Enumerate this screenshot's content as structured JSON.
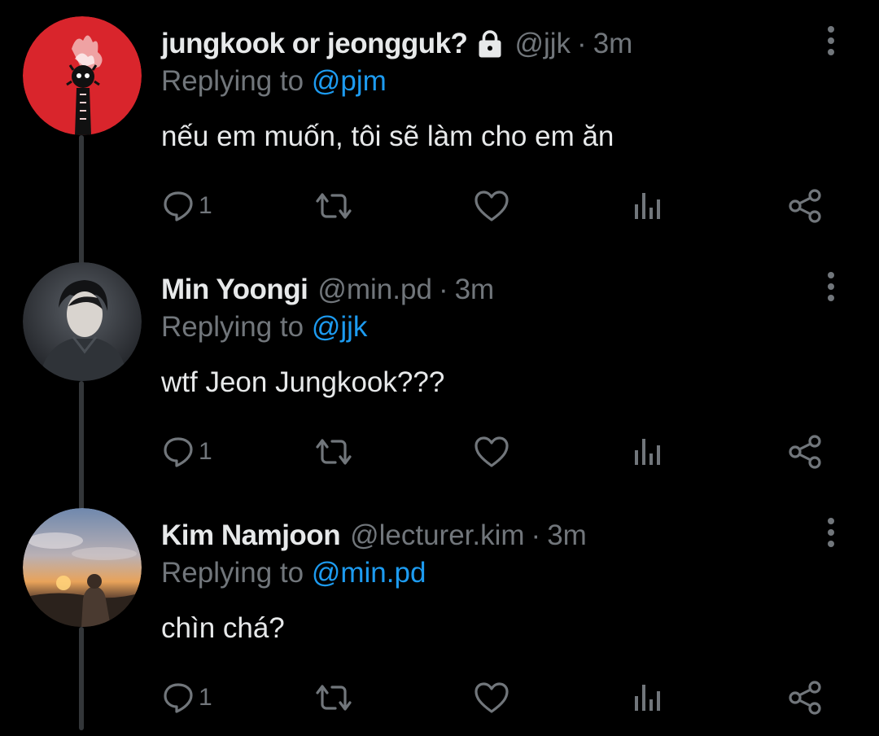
{
  "colors": {
    "background": "#000000",
    "text_primary": "#e7e9ea",
    "text_secondary": "#71767b",
    "link": "#1d9bf0",
    "thread_line": "#333639"
  },
  "tweets": [
    {
      "display_name": "jungkook or jeongguk?",
      "protected": true,
      "handle": "@jjk",
      "separator": "·",
      "time": "3m",
      "replying_prefix": "Replying to",
      "replying_to": "@pjm",
      "text": "nếu em muốn, tôi sẽ làm cho em ăn",
      "reply_count": "1",
      "avatar_icon": "red-circle-fire-avatar"
    },
    {
      "display_name": "Min Yoongi",
      "protected": false,
      "handle": "@min.pd",
      "separator": "·",
      "time": "3m",
      "replying_prefix": "Replying to",
      "replying_to": "@jjk",
      "text": "wtf Jeon Jungkook???",
      "reply_count": "1",
      "avatar_icon": "portrait-photo-avatar"
    },
    {
      "display_name": "Kim Namjoon",
      "protected": false,
      "handle": "@lecturer.kim",
      "separator": "·",
      "time": "3m",
      "replying_prefix": "Replying to",
      "replying_to": "@min.pd",
      "text": "chìn chá?",
      "reply_count": "1",
      "avatar_icon": "sunset-photo-avatar"
    }
  ],
  "icons": {
    "reply": "reply-icon",
    "retweet": "retweet-icon",
    "like": "heart-icon",
    "views": "analytics-icon",
    "share": "share-icon",
    "more": "more-options-icon",
    "lock": "lock-icon"
  }
}
